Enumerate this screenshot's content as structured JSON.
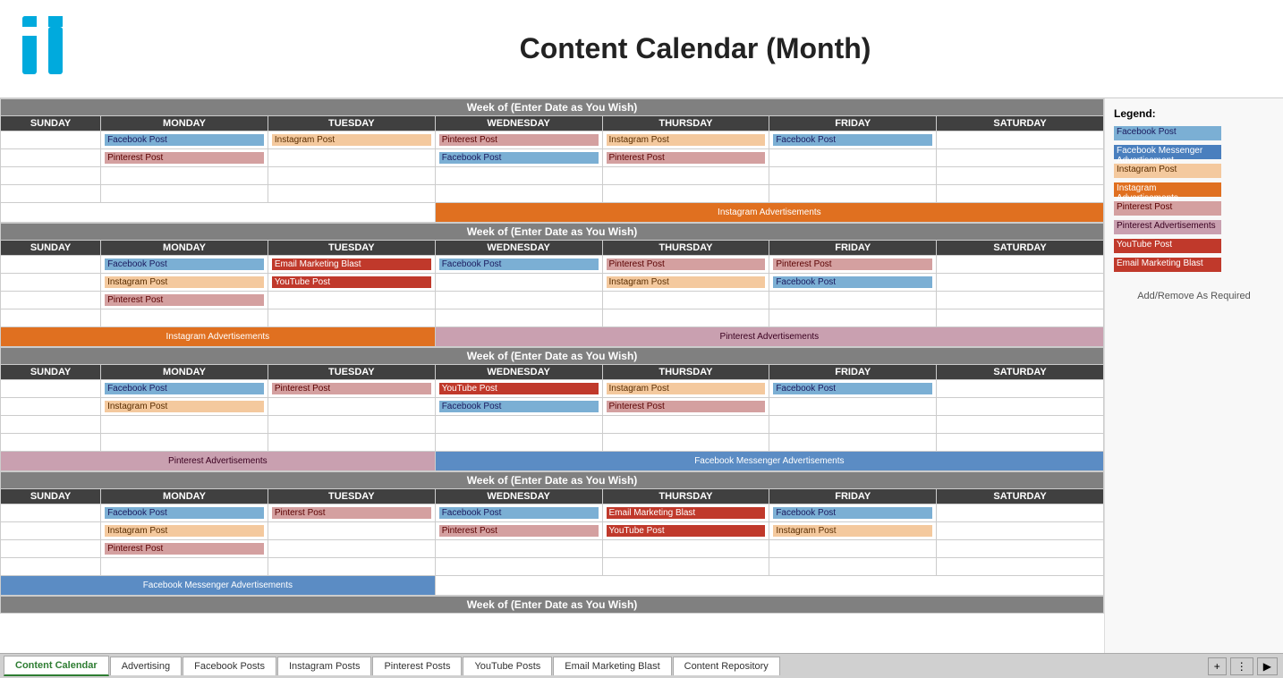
{
  "header": {
    "title": "Content Calendar (Month)"
  },
  "legend": {
    "title": "Legend:",
    "items": [
      {
        "label": "Facebook Post",
        "class": "fb-post"
      },
      {
        "label": "Facebook Messenger Advertisement",
        "class": "fb-messenger"
      },
      {
        "label": "Instagram Post",
        "class": "ig-post"
      },
      {
        "label": "Instagram Advertisements",
        "class": "ig-ads"
      },
      {
        "label": "Pinterest Post",
        "class": "pin-post"
      },
      {
        "label": "Pinterest Advertisements",
        "class": "pin-ads"
      },
      {
        "label": "YouTube Post",
        "class": "yt-post"
      },
      {
        "label": "Email Marketing Blast",
        "class": "email-blast"
      }
    ],
    "note": "Add/Remove As Required"
  },
  "weeks": [
    {
      "header": "Week of (Enter Date as You Wish)",
      "days": [
        "SUNDAY",
        "MONDAY",
        "TUESDAY",
        "WEDNESDAY",
        "THURSDAY",
        "FRIDAY",
        "SATURDAY"
      ],
      "rows": [
        {
          "sunday": [],
          "monday": [
            "Facebook Post",
            "fb-post"
          ],
          "tuesday": [
            "Instagram Post",
            "ig-post"
          ],
          "wednesday": [
            "Pinterest Post",
            "pin-post"
          ],
          "thursday": [
            "Instagram Post",
            "ig-post"
          ],
          "friday": [
            "Facebook Post",
            "fb-post"
          ],
          "saturday": []
        },
        {
          "sunday": [],
          "monday": [
            "Pinterest Post",
            "pin-post"
          ],
          "tuesday": [],
          "wednesday": [
            "Facebook Post",
            "fb-post"
          ],
          "thursday": [
            "Pinterest Post",
            "pin-post"
          ],
          "friday": [],
          "saturday": []
        },
        {
          "sunday": [],
          "monday": [],
          "tuesday": [],
          "wednesday": [],
          "thursday": [],
          "friday": [],
          "saturday": []
        },
        {
          "sunday": [],
          "monday": [],
          "tuesday": [],
          "wednesday": [],
          "thursday": [],
          "friday": [],
          "saturday": []
        }
      ],
      "adRow": {
        "type": "ig-ads",
        "leftSpan": 3,
        "leftLabel": "",
        "rightSpan": 4,
        "rightLabel": "Instagram Advertisements",
        "rightClass": "ig-ads-cell"
      }
    },
    {
      "header": "Week of (Enter Date as You Wish)",
      "days": [
        "SUNDAY",
        "MONDAY",
        "TUESDAY",
        "WEDNESDAY",
        "THURSDAY",
        "FRIDAY",
        "SATURDAY"
      ],
      "rows": [
        {
          "sunday": [],
          "monday": [
            "Facebook Post",
            "fb-post"
          ],
          "tuesday": [
            "Email Marketing Blast",
            "email-blast"
          ],
          "wednesday": [
            "Facebook Post",
            "fb-post"
          ],
          "thursday": [
            "Pinterest Post",
            "pin-post"
          ],
          "friday": [
            "Pinterest Post",
            "pin-post"
          ],
          "saturday": []
        },
        {
          "sunday": [],
          "monday": [
            "Instagram Post",
            "ig-post"
          ],
          "tuesday": [
            "YouTube Post",
            "yt-post"
          ],
          "wednesday": [],
          "thursday": [
            "Instagram Post",
            "ig-post"
          ],
          "friday": [
            "Facebook Post",
            "fb-post"
          ],
          "saturday": []
        },
        {
          "sunday": [],
          "monday": [
            "Pinterest Post",
            "pin-post"
          ],
          "tuesday": [],
          "wednesday": [],
          "thursday": [],
          "friday": [],
          "saturday": []
        },
        {
          "sunday": [],
          "monday": [],
          "tuesday": [],
          "wednesday": [],
          "thursday": [],
          "friday": [],
          "saturday": []
        }
      ],
      "adRow": {
        "leftSpan": 3,
        "leftLabel": "Instagram Advertisements",
        "leftClass": "ig-ads-cell",
        "rightSpan": 4,
        "rightLabel": "Pinterest Advertisements",
        "rightClass": "pin-ads-cell"
      }
    },
    {
      "header": "Week of (Enter Date as You Wish)",
      "days": [
        "SUNDAY",
        "MONDAY",
        "TUESDAY",
        "WEDNESDAY",
        "THURSDAY",
        "FRIDAY",
        "SATURDAY"
      ],
      "rows": [
        {
          "sunday": [],
          "monday": [
            "Facebook Post",
            "fb-post"
          ],
          "tuesday": [
            "Pinterest Post",
            "pin-post"
          ],
          "wednesday": [
            "YouTube Post",
            "yt-post"
          ],
          "thursday": [
            "Instagram Post",
            "ig-post"
          ],
          "friday": [
            "Facebook Post",
            "fb-post"
          ],
          "saturday": []
        },
        {
          "sunday": [],
          "monday": [
            "Instagram Post",
            "ig-post"
          ],
          "tuesday": [],
          "wednesday": [
            "Facebook Post",
            "fb-post"
          ],
          "thursday": [
            "Pinterest Post",
            "pin-post"
          ],
          "friday": [],
          "saturday": []
        },
        {
          "sunday": [],
          "monday": [],
          "tuesday": [],
          "wednesday": [],
          "thursday": [],
          "friday": [],
          "saturday": []
        },
        {
          "sunday": [],
          "monday": [],
          "tuesday": [],
          "wednesday": [],
          "thursday": [],
          "friday": [],
          "saturday": []
        }
      ],
      "adRow": {
        "leftSpan": 3,
        "leftLabel": "Pinterest Advertisements",
        "leftClass": "pin-ads-cell",
        "rightSpan": 4,
        "rightLabel": "Facebook Messenger Advertisements",
        "rightClass": "fb-msg-ads-cell"
      }
    },
    {
      "header": "Week of (Enter Date as You Wish)",
      "days": [
        "SUNDAY",
        "MONDAY",
        "TUESDAY",
        "WEDNESDAY",
        "THURSDAY",
        "FRIDAY",
        "SATURDAY"
      ],
      "rows": [
        {
          "sunday": [],
          "monday": [
            "Facebook Post",
            "fb-post"
          ],
          "tuesday": [
            "Pinterst Post",
            "pin-post"
          ],
          "wednesday": [
            "Facebook Post",
            "fb-post"
          ],
          "thursday": [
            "Email Marketing Blast",
            "email-blast"
          ],
          "friday": [
            "Facebook Post",
            "fb-post"
          ],
          "saturday": []
        },
        {
          "sunday": [],
          "monday": [
            "Instagram Post",
            "ig-post"
          ],
          "tuesday": [],
          "wednesday": [
            "Pinterest Post",
            "pin-post"
          ],
          "thursday": [
            "YouTube Post",
            "yt-post"
          ],
          "friday": [
            "Instagram Post",
            "ig-post"
          ],
          "saturday": []
        },
        {
          "sunday": [],
          "monday": [
            "Pinterest Post",
            "pin-post"
          ],
          "tuesday": [],
          "wednesday": [],
          "thursday": [],
          "friday": [],
          "saturday": []
        },
        {
          "sunday": [],
          "monday": [],
          "tuesday": [],
          "wednesday": [],
          "thursday": [],
          "friday": [],
          "saturday": []
        }
      ],
      "adRow": {
        "leftSpan": 3,
        "leftLabel": "Facebook Messenger Advertisements",
        "leftClass": "fb-msg-ads-cell",
        "rightSpan": 4,
        "rightLabel": "",
        "rightClass": "empty-ad"
      }
    }
  ],
  "week5_header": "Week of (Enter Date as You Wish)",
  "tabs": [
    {
      "label": "Content Calendar",
      "active": true
    },
    {
      "label": "Advertising",
      "active": false
    },
    {
      "label": "Facebook Posts",
      "active": false
    },
    {
      "label": "Instagram Posts",
      "active": false
    },
    {
      "label": "Pinterest Posts",
      "active": false
    },
    {
      "label": "YouTube Posts",
      "active": false
    },
    {
      "label": "Email Marketing Blast",
      "active": false
    },
    {
      "label": "Content Repository",
      "active": false
    }
  ]
}
